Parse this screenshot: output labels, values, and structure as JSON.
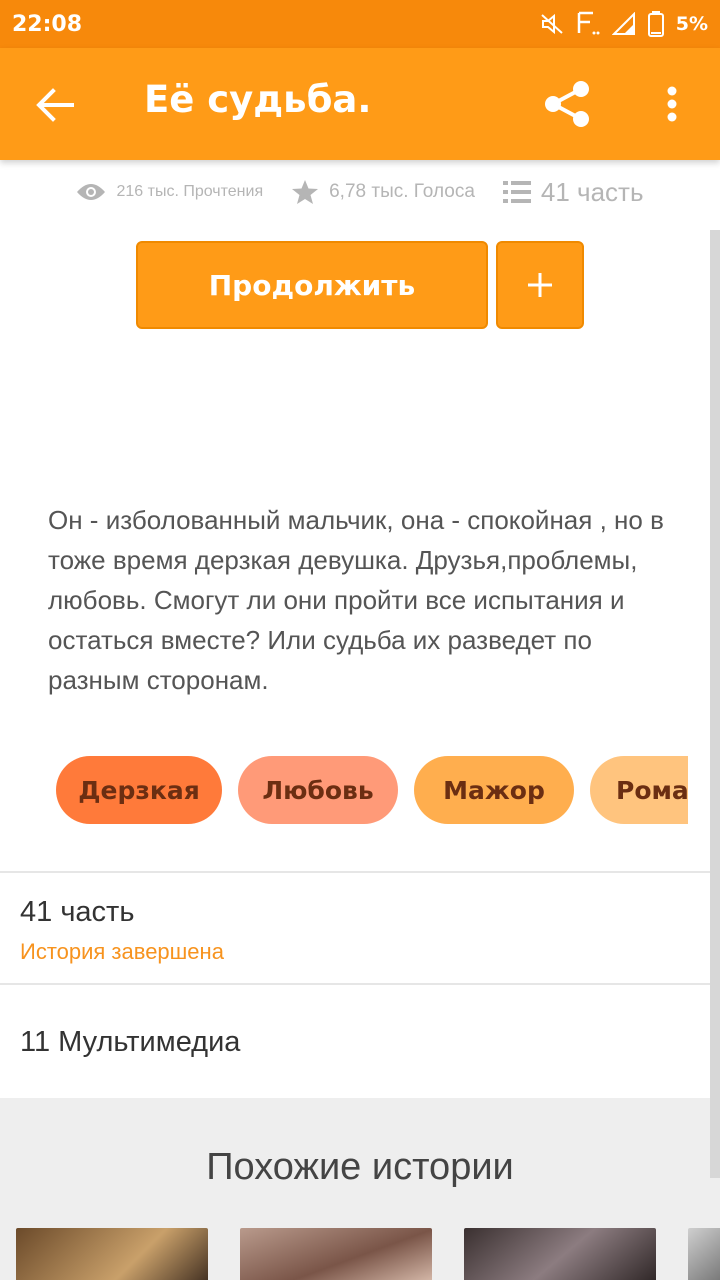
{
  "status_bar": {
    "time": "22:08",
    "battery": "5%",
    "icons": [
      "mute-icon",
      "network-f-icon",
      "signal-icon",
      "battery-icon"
    ]
  },
  "app_bar": {
    "title": "Её судьба.",
    "back_icon": "arrow-back-icon",
    "share_icon": "share-icon",
    "more_icon": "more-vert-icon"
  },
  "stats": {
    "reads": "216 тыс. Прочтения",
    "votes": "6,78 тыс. Голоса",
    "parts": "41 часть"
  },
  "actions": {
    "continue_label": "Продолжить",
    "add_icon": "plus-icon"
  },
  "description": "Он - изболованный мальчик, она - спокойная , но в тоже время дерзкая девушка. Друзья,проблемы, любовь. Смогут ли они пройти все испытания и остаться вместе? Или судьба их разведет по разным сторонам.",
  "tags": [
    "Дерзкая",
    "Любовь",
    "Мажор",
    "Романтика"
  ],
  "parts_section": {
    "count": "41 часть",
    "status": "История завершена"
  },
  "multimedia": "11 Мультимедиа",
  "similar": {
    "title": "Похожие истории"
  },
  "colors": {
    "status_bar": "#F7890B",
    "app_bar": "#FF9B17",
    "accent_text": "#F7931E"
  }
}
